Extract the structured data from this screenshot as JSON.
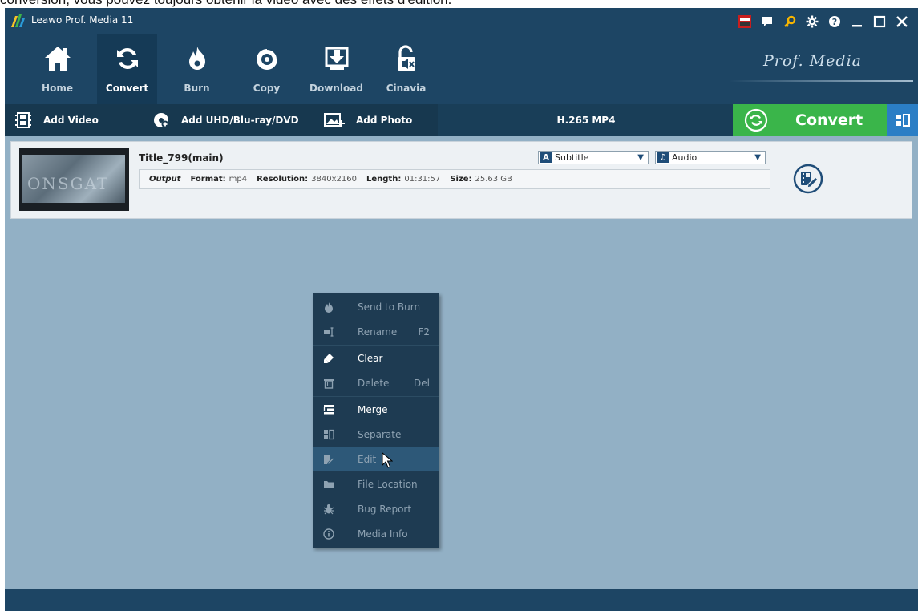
{
  "caption": "conversion, vous pouvez toujours obtenir la vidéo avec des effets d'édition.",
  "window": {
    "title": "Leawo Prof. Media 11",
    "brand": "Prof. Media",
    "titlebar_icons": [
      "amd-badge-icon",
      "feedback-icon",
      "key-icon",
      "gear-icon",
      "help-icon",
      "minimize-icon",
      "maximize-icon",
      "close-icon"
    ]
  },
  "nav": {
    "items": [
      {
        "label": "Home",
        "icon": "home-icon"
      },
      {
        "label": "Convert",
        "icon": "convert-icon",
        "active": true
      },
      {
        "label": "Burn",
        "icon": "burn-icon"
      },
      {
        "label": "Copy",
        "icon": "copy-icon"
      },
      {
        "label": "Download",
        "icon": "download-icon"
      },
      {
        "label": "Cinavia",
        "icon": "cinavia-icon"
      }
    ]
  },
  "actions": {
    "add_video": "Add Video",
    "add_disc": "Add UHD/Blu-ray/DVD",
    "add_photo": "Add Photo",
    "format": "H.265 MP4",
    "convert": "Convert"
  },
  "file": {
    "title": "Title_799(main)",
    "output_label": "Output",
    "format_label": "Format:",
    "format_value": "mp4",
    "resolution_label": "Resolution:",
    "resolution_value": "3840x2160",
    "length_label": "Length:",
    "length_value": "01:31:57",
    "size_label": "Size:",
    "size_value": "25.63 GB",
    "thumb_text": "ONSGAT",
    "subtitle_select": "Subtitle",
    "audio_select": "Audio"
  },
  "context_menu": {
    "items": [
      {
        "label": "Send to Burn",
        "icon": "burn-icon",
        "enabled": false
      },
      {
        "label": "Rename",
        "shortcut": "F2",
        "icon": "rename-icon",
        "enabled": false
      },
      {
        "label": "Clear",
        "icon": "clear-icon",
        "enabled": true
      },
      {
        "label": "Delete",
        "shortcut": "Del",
        "icon": "delete-icon",
        "enabled": false
      },
      {
        "label": "Merge",
        "icon": "merge-icon",
        "enabled": true
      },
      {
        "label": "Separate",
        "icon": "separate-icon",
        "enabled": false
      },
      {
        "label": "Edit",
        "icon": "edit-icon",
        "enabled": false,
        "hovered": true
      },
      {
        "label": "File Location",
        "icon": "folder-icon",
        "enabled": false
      },
      {
        "label": "Bug Report",
        "icon": "bug-icon",
        "enabled": false
      },
      {
        "label": "Media Info",
        "icon": "info-icon",
        "enabled": false
      }
    ]
  },
  "colors": {
    "header": "#1d4564",
    "workspace": "#92b0c5",
    "convert_green": "#3ab54a",
    "menu_bg": "#1e3b52"
  }
}
